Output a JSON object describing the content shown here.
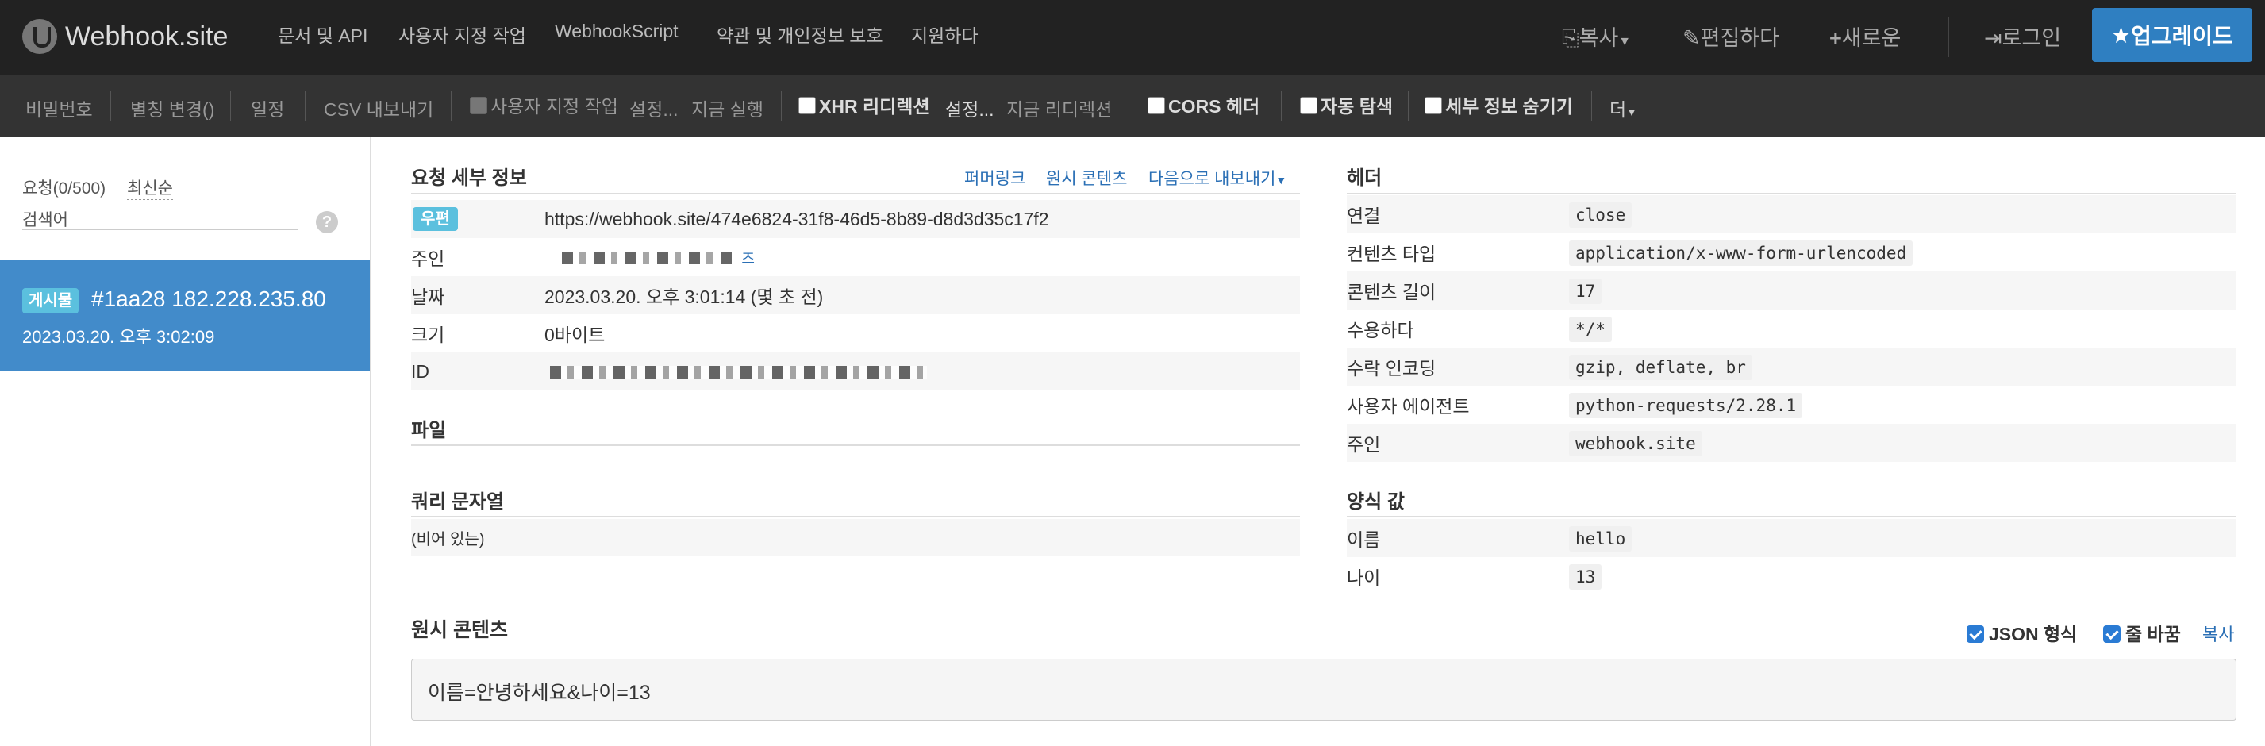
{
  "brand": {
    "name": "Webhook.site"
  },
  "nav": {
    "links": [
      "문서 및 API",
      "사용자 지정 작업",
      "WebhookScript",
      "약관 및 개인정보 보호",
      "지원하다"
    ],
    "copy": "복사",
    "edit": "편집하다",
    "new": "새로운",
    "login": "로그인",
    "upgrade": "업그레이드"
  },
  "toolbar": {
    "password": "비밀번호",
    "alias": "별칭 변경()",
    "schedule": "일정",
    "csv": "CSV 내보내기",
    "custom_actions": "사용자 지정 작업",
    "custom_settings": "설정...",
    "run_now": "지금 실행",
    "xhr_redirect": "XHR 리디렉션",
    "xhr_settings": "설정...",
    "redirect_now": "지금 리디렉션",
    "cors": "CORS 헤더",
    "auto_nav": "자동 탐색",
    "hide_details": "세부 정보 숨기기",
    "more": "더"
  },
  "sidebar": {
    "requests_label": "요청(0/500)",
    "sort": "최신순",
    "search_placeholder": "검색어",
    "help": "?",
    "items": [
      {
        "method": "게시물",
        "id_ip": "#1aa28 182.228.235.80",
        "date": "2023.03.20. 오후 3:02:09"
      }
    ]
  },
  "details": {
    "title": "요청 세부 정보",
    "permalink": "퍼머링크",
    "raw_content": "원시 콘텐츠",
    "export": "다음으로 내보내기",
    "method_badge": "우편",
    "url": "https://webhook.site/474e6824-31f8-46d5-8b89-d8d3d35c17f2",
    "host_label": "주인",
    "host_value_suffix": "즈",
    "date_label": "날짜",
    "date_value": "2023.03.20. 오후 3:01:14 (몇 초 전)",
    "size_label": "크기",
    "size_value": "0바이트",
    "id_label": "ID"
  },
  "files": {
    "title": "파일"
  },
  "query": {
    "title": "쿼리 문자열",
    "empty": "(비어 있는)"
  },
  "headers": {
    "title": "헤더",
    "rows": [
      {
        "k": "연결",
        "v": "close"
      },
      {
        "k": "컨텐츠 타입",
        "v": "application/x-www-form-urlencoded"
      },
      {
        "k": "콘텐츠 길이",
        "v": "17"
      },
      {
        "k": "수용하다",
        "v": "*/*"
      },
      {
        "k": "수락 인코딩",
        "v": "gzip, deflate, br"
      },
      {
        "k": "사용자 에이전트",
        "v": "python-requests/2.28.1"
      },
      {
        "k": "주인",
        "v": "webhook.site"
      }
    ]
  },
  "form": {
    "title": "양식 값",
    "rows": [
      {
        "k": "이름",
        "v": "hello"
      },
      {
        "k": "나이",
        "v": "13"
      }
    ]
  },
  "raw": {
    "title": "원시 콘텐츠",
    "json_format": "JSON 형식",
    "word_wrap": "줄 바꿈",
    "copy": "복사",
    "content": "이름=안녕하세요&나이=13"
  },
  "colors": {
    "navbar": "#222222",
    "toolbar": "#333333",
    "accent": "#428bca",
    "upgrade": "#2f7fc1",
    "badge": "#5bc0de"
  }
}
